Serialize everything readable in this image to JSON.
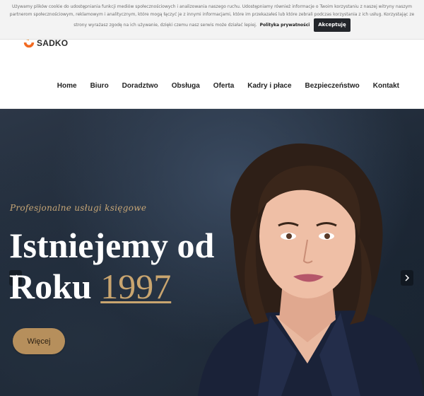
{
  "cookie": {
    "text": "Używamy plików cookie do udostępniania funkcji mediów społecznościowych i analizowania naszego ruchu. Udostępniamy również informacje o Twoim korzystaniu z naszej witryny naszym partnerom społecznościowym, reklamowym i analitycznym, które mogą łączyć je z innymi informacjami, które im przekazałeś lub które zebrali podczas korzystania z ich usług. Korzystając ze strony wyrażasz zgodę na ich używanie, dzięki czemu nasz serwis może działać lepiej.",
    "policy_link": "Polityka prywatności",
    "accept_label": "Akceptuję"
  },
  "header": {
    "logo_text": "SADKO",
    "nav": [
      "Home",
      "Biuro",
      "Doradztwo",
      "Obsługa",
      "Oferta",
      "Kadry i płace",
      "Bezpieczeństwo",
      "Kontakt"
    ]
  },
  "hero": {
    "eyebrow": "Profesjonalne usługi księgowe",
    "headline_line1": "Istniejemy od",
    "headline_line2": "Roku",
    "year": "1997",
    "button_label": "Więcej"
  },
  "colors": {
    "accent_gold": "#c9a56f",
    "button_bg": "#b68f5c",
    "logo_orange": "#f26a21"
  },
  "icons": {
    "slider_prev": "chevron-left-icon",
    "slider_next": "chevron-right-icon"
  }
}
